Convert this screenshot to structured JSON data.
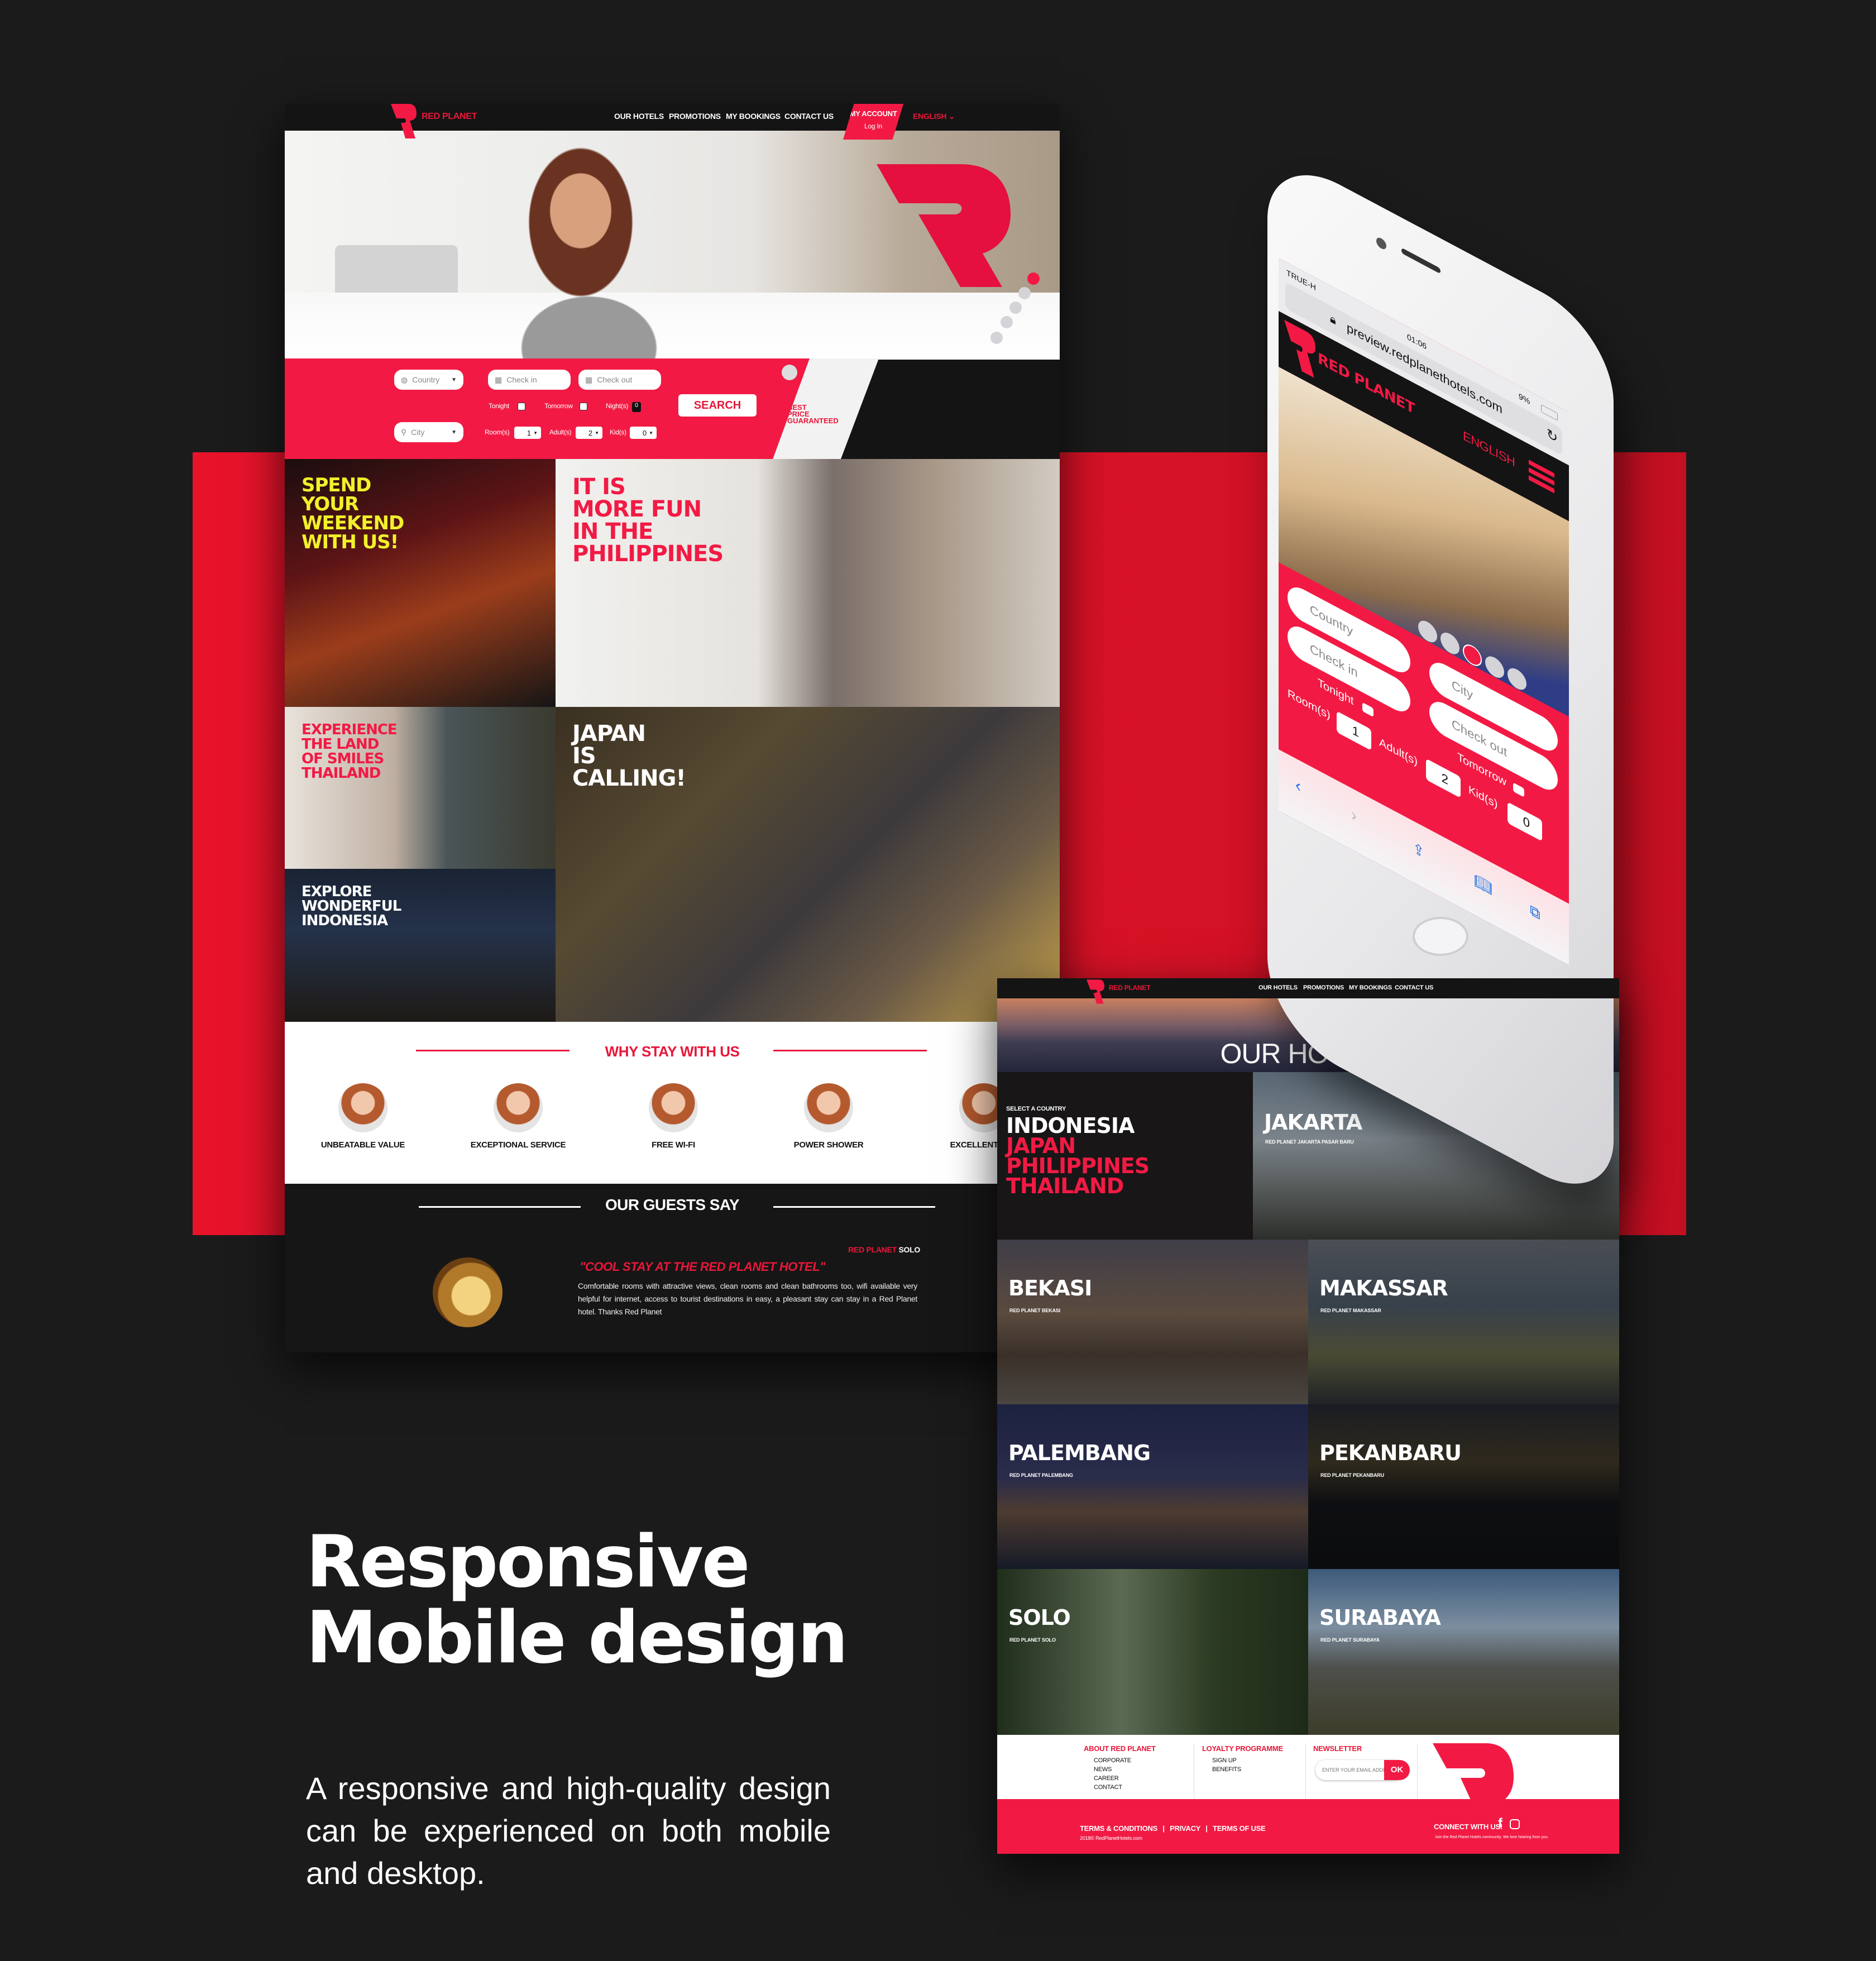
{
  "colors": {
    "brand_red": "#f21a44",
    "band_red": "#e8132b",
    "background": "#1b1b1b",
    "dark_panel": "#141414"
  },
  "headline": {
    "line1": "Responsive",
    "line2": "Mobile design",
    "subcopy": "A responsive and high-quality design can be experienced on both mobile and desktop."
  },
  "desktop": {
    "brand": "RED PLANET",
    "nav": [
      "OUR HOTELS",
      "PROMOTIONS",
      "MY BOOKINGS",
      "CONTACT US"
    ],
    "account": {
      "label": "MY ACCOUNT",
      "sub": "Log In"
    },
    "language": "ENGLISH",
    "search": {
      "country_placeholder": "Country",
      "city_placeholder": "City",
      "checkin_placeholder": "Check in",
      "checkout_placeholder": "Check out",
      "tonight": "Tonight",
      "tomorrow": "Tomorrow",
      "nights_label": "Night(s)",
      "nights_value": "0",
      "rooms_label": "Room(s)",
      "rooms_value": "1",
      "adults_label": "Adult(s)",
      "adults_value": "2",
      "kids_label": "Kid(s)",
      "kids_value": "0",
      "button": "SEARCH",
      "best_price": [
        "BEST",
        "PRICE",
        "GUARANTEED"
      ]
    },
    "hero_slides": {
      "count": 5,
      "active": 1
    },
    "promos": [
      {
        "text": [
          "SPEND",
          "YOUR",
          "WEEKEND",
          "WITH US!"
        ],
        "color": "#f1f12a"
      },
      {
        "text": [
          "IT IS",
          "MORE FUN",
          "IN THE",
          "PHILIPPINES"
        ],
        "color": "#f21a44"
      },
      {
        "text": [
          "EXPERIENCE",
          "THE LAND",
          "OF SMILES",
          "THAILAND"
        ],
        "color": "#f21a44"
      },
      {
        "text": [
          "JAPAN",
          "IS",
          "CALLING!"
        ],
        "color": "#ffffff"
      },
      {
        "text": [
          "EXPLORE",
          "WONDERFUL",
          "INDONESIA"
        ],
        "color": "#ffffff"
      }
    ],
    "why": {
      "title": "WHY STAY WITH US",
      "items": [
        "UNBEATABLE VALUE",
        "EXCEPTIONAL SERVICE",
        "FREE WI-FI",
        "POWER SHOWER",
        "EXCELLENT LOC"
      ]
    },
    "guests": {
      "title": "OUR GUESTS SAY",
      "hotel_prefix": "RED PLANET",
      "hotel_name": "SOLO",
      "quote": "\"COOL STAY AT THE RED PLANET HOTEL\"",
      "body": "Comfortable rooms with attractive views, clean rooms and clean bathrooms too, wifi available very helpful for internet, access to tourist destinations in easy, a pleasant stay can stay in a Red Planet hotel. Thanks Red Planet"
    }
  },
  "hotels_page": {
    "brand": "RED PLANET",
    "nav": [
      "OUR HOTELS",
      "PROMOTIONS",
      "MY BOOKINGS",
      "CONTACT US"
    ],
    "hero_title": "OUR HOTELS",
    "select_label": "SELECT A COUNTRY",
    "countries": [
      {
        "name": "INDONESIA",
        "active": true
      },
      {
        "name": "JAPAN",
        "active": false
      },
      {
        "name": "PHILIPPINES",
        "active": false
      },
      {
        "name": "THAILAND",
        "active": false
      }
    ],
    "cities": [
      {
        "name": "JAKARTA",
        "hotel": "RED PLANET JAKARTA PASAR BARU"
      },
      {
        "name": "BEKASI",
        "hotel": "RED PLANET BEKASI"
      },
      {
        "name": "MAKASSAR",
        "hotel": "RED PLANET MAKASSAR"
      },
      {
        "name": "PALEMBANG",
        "hotel": "RED PLANET PALEMBANG"
      },
      {
        "name": "PEKANBARU",
        "hotel": "RED PLANET PEKANBARU"
      },
      {
        "name": "SOLO",
        "hotel": "RED PLANET SOLO"
      },
      {
        "name": "SURABAYA",
        "hotel": "RED PLANET SURABAYA"
      }
    ],
    "footer": {
      "about": {
        "title": "ABOUT RED PLANET",
        "links": [
          "CORPORATE",
          "NEWS",
          "CAREER",
          "CONTACT"
        ]
      },
      "loyalty": {
        "title": "LOYALTY PROGRAMME",
        "links": [
          "SIGN UP",
          "BENEFITS"
        ]
      },
      "newsletter": {
        "title": "NEWSLETTER",
        "placeholder": "ENTER YOUR EMAIL ADDRESS",
        "button": "OK"
      },
      "legal": [
        "TERMS & CONDITIONS",
        "PRIVACY",
        "TERMS OF USE"
      ],
      "copyright": "2018© RedPlanetHotels.com",
      "connect": "CONNECT WITH US!",
      "connect_sub": "Join the Red Planet Hotels community. We love hearing from you."
    }
  },
  "phone": {
    "carrier": "TRUE-H",
    "time": "01:06",
    "battery": "9%",
    "url": "preview.redplanethotels.com",
    "brand": "RED PLANET",
    "language": "ENGLISH",
    "search": {
      "country_placeholder": "Country",
      "city_placeholder": "City",
      "checkin_placeholder": "Check in",
      "checkout_placeholder": "Check out",
      "tonight": "Tonight",
      "tomorrow": "Tomorrow",
      "rooms_label": "Room(s)",
      "rooms_value": "1",
      "adults_label": "Adult(s)",
      "adults_value": "2",
      "kids_label": "Kid(s)",
      "kids_value": "0"
    },
    "slides": {
      "count": 5,
      "active": 3
    }
  }
}
